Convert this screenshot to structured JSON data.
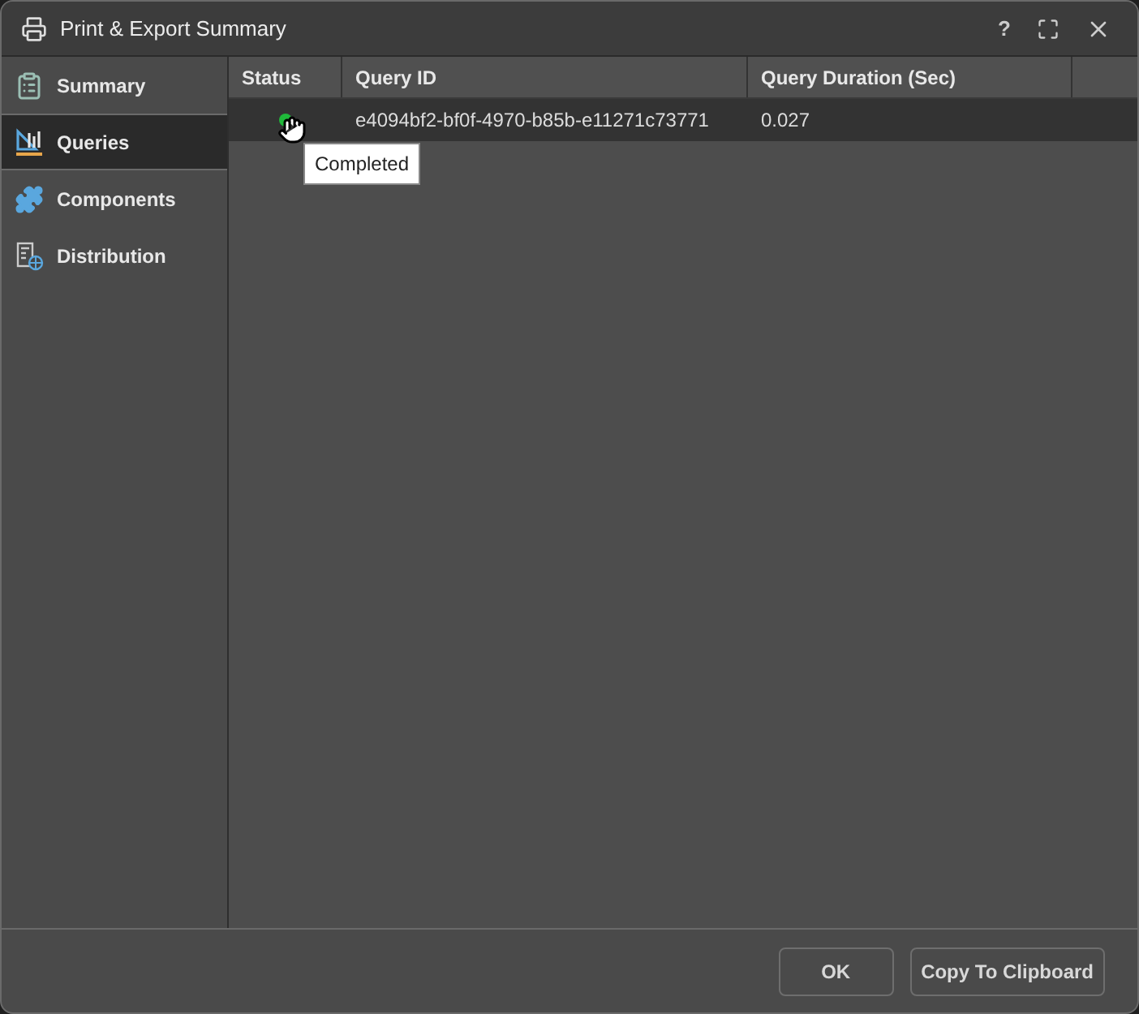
{
  "window": {
    "title": "Print & Export Summary",
    "help": "?"
  },
  "sidebar": {
    "items": [
      {
        "label": "Summary",
        "selected": false
      },
      {
        "label": "Queries",
        "selected": true
      },
      {
        "label": "Components",
        "selected": false
      },
      {
        "label": "Distribution",
        "selected": false
      }
    ]
  },
  "table": {
    "columns": [
      "Status",
      "Query ID",
      "Query Duration (Sec)"
    ],
    "rows": [
      {
        "color": "#1fb83a",
        "query_id": "e4094bf2-bf0f-4970-b85b-e11271c73771",
        "duration": "0.027",
        "selected": true
      }
    ]
  },
  "tooltip": "Completed",
  "buttons": [
    "OK",
    "Copy To Clipboard"
  ]
}
